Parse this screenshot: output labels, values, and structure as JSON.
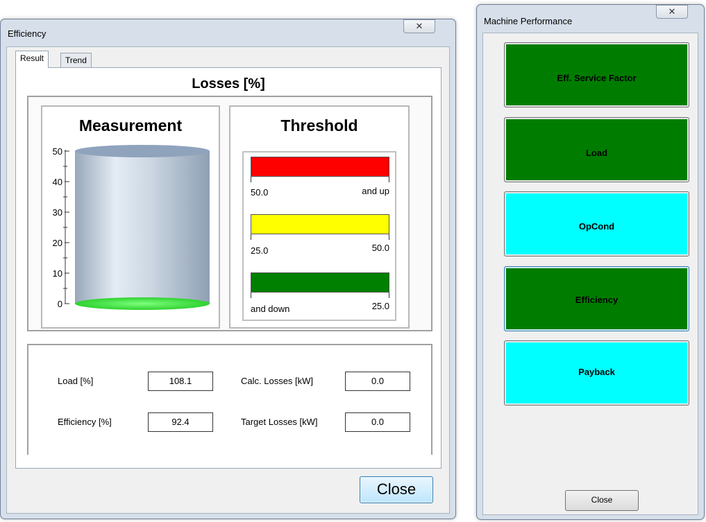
{
  "efficiency_window": {
    "title": "Efficiency",
    "close_glyph": "✕",
    "tabs": [
      {
        "label": "Result",
        "selected": true
      },
      {
        "label": "Trend",
        "selected": false
      }
    ],
    "chart_title": "Losses [%]",
    "measurement": {
      "title": "Measurement",
      "axis_ticks": [
        "50",
        "40",
        "30",
        "20",
        "10",
        "0"
      ],
      "ylim": [
        0,
        50
      ],
      "value": 0
    },
    "threshold": {
      "title": "Threshold",
      "bands": [
        {
          "color": "#ff0000",
          "left_label": "50.0",
          "right_label": "and up"
        },
        {
          "color": "#ffff00",
          "left_label": "25.0",
          "right_label": "50.0"
        },
        {
          "color": "#008000",
          "left_label": "and down",
          "right_label": "25.0"
        }
      ]
    },
    "info": {
      "load_label": "Load [%]",
      "load_value": "108.1",
      "efficiency_label": "Efficiency [%]",
      "efficiency_value": "92.4",
      "calc_losses_label": "Calc. Losses [kW]",
      "calc_losses_value": "0.0",
      "target_losses_label": "Target Losses [kW]",
      "target_losses_value": "0.0"
    },
    "close_label": "Close"
  },
  "machine_performance_window": {
    "title": "Machine Performance",
    "close_glyph": "✕",
    "buttons": [
      {
        "label": "Eff. Service Factor",
        "color": "#007d00"
      },
      {
        "label": "Load",
        "color": "#007d00"
      },
      {
        "label": "OpCond",
        "color": "#00ffff"
      },
      {
        "label": "Efficiency",
        "color": "#007d00"
      },
      {
        "label": "Payback",
        "color": "#00ffff"
      }
    ],
    "close_label": "Close"
  }
}
